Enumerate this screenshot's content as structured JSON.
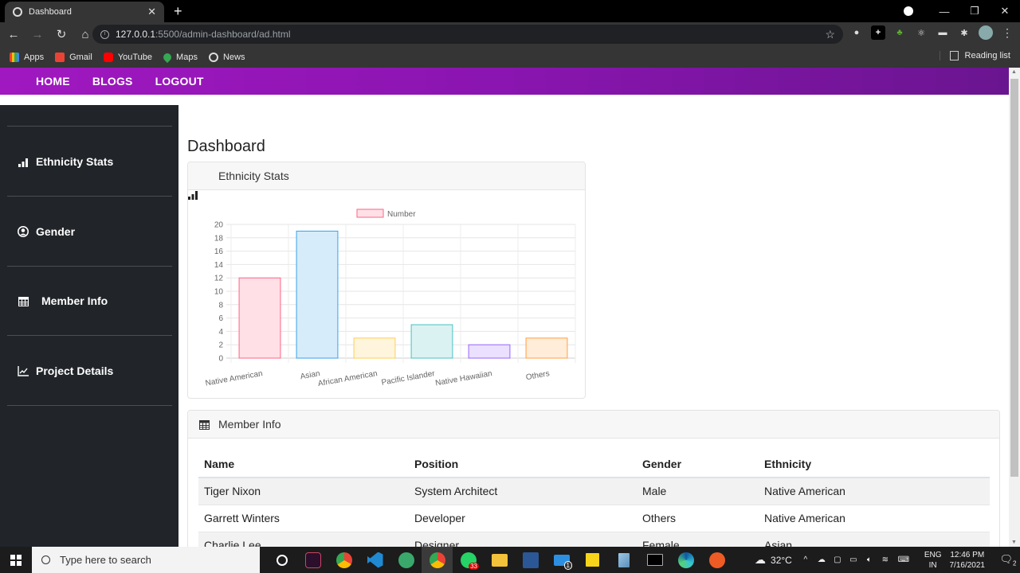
{
  "browser": {
    "tab_title": "Dashboard",
    "url_host": "127.0.0.1",
    "url_path": ":5500/admin-dashboard/ad.html",
    "bookmarks": [
      "Apps",
      "Gmail",
      "YouTube",
      "Maps",
      "News"
    ],
    "reading_list": "Reading list"
  },
  "topnav": {
    "items": [
      "HOME",
      "BLOGS",
      "LOGOUT"
    ],
    "gradient_start": "#a018c0",
    "gradient_end": "#6a1590"
  },
  "sidebar": {
    "items": [
      {
        "label": "Ethnicity Stats",
        "icon": "bar-chart-icon"
      },
      {
        "label": "Gender",
        "icon": "user-circle-icon"
      },
      {
        "label": "Member Info",
        "icon": "table-icon"
      },
      {
        "label": "Project Details",
        "icon": "line-chart-icon"
      }
    ]
  },
  "main": {
    "title": "Dashboard",
    "chart_card_title": "Ethnicity Stats",
    "table_card_title": "Member Info"
  },
  "chart_data": {
    "type": "bar",
    "title": "",
    "legend": [
      "Number"
    ],
    "legend_position": "top",
    "categories": [
      "Native American",
      "Asian",
      "African American",
      "Pacific Islander",
      "Native Hawaiian",
      "Others"
    ],
    "series": [
      {
        "name": "Number",
        "values": [
          12,
          19,
          3,
          5,
          2,
          3
        ]
      }
    ],
    "ylim": [
      0,
      20
    ],
    "yticks": [
      0,
      2,
      4,
      6,
      8,
      10,
      12,
      14,
      16,
      18,
      20
    ],
    "xlabel": "",
    "ylabel": "",
    "grid": true,
    "fill_colors": [
      "#ffe0e6",
      "#d7ecfb",
      "#fff5dd",
      "#dbf2f2",
      "#ebe0ff",
      "#ffecd9"
    ],
    "border_colors": [
      "#ff6384",
      "#36a2eb",
      "#ffce56",
      "#4bc0c0",
      "#9966ff",
      "#ff9f40"
    ]
  },
  "table": {
    "columns": [
      "Name",
      "Position",
      "Gender",
      "Ethnicity"
    ],
    "rows": [
      [
        "Tiger Nixon",
        "System Architect",
        "Male",
        "Native American"
      ],
      [
        "Garrett Winters",
        "Developer",
        "Others",
        "Native American"
      ],
      [
        "Charlie Lee",
        "Designer",
        "Female",
        "Asian"
      ]
    ]
  },
  "taskbar": {
    "search_placeholder": "Type here to search",
    "whatsapp_badge": "33",
    "mail_badge": "1",
    "weather": "32°C",
    "lang_top": "ENG",
    "lang_bottom": "IN",
    "time": "12:46 PM",
    "date": "7/16/2021",
    "notifications": "2"
  }
}
